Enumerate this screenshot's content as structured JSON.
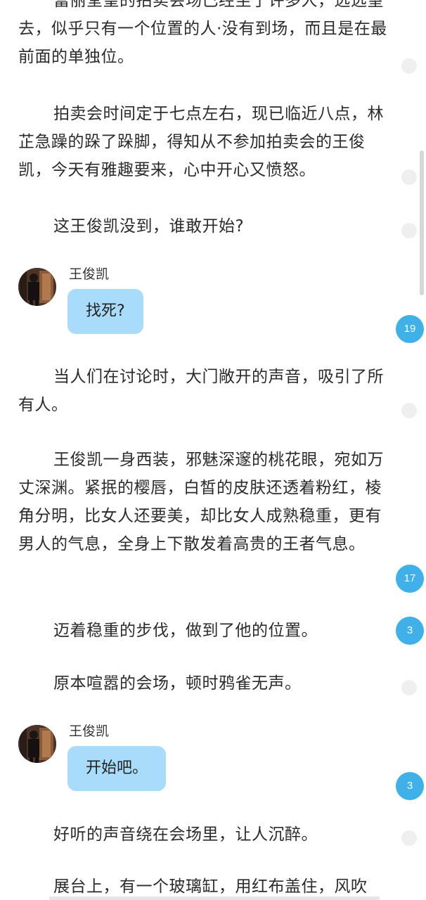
{
  "story": {
    "paragraphs": [
      "富丽堂皇的拍卖会场已经坐了许多人，远远望去，似乎只有一个位置的人·没有到场，而且是在最前面的单独位。",
      "拍卖会时间定于七点左右，现已临近八点，林芷急躁的跺了跺脚，得知从不参加拍卖会的王俊凯，今天有雅趣要来，心中开心又愤怒。",
      "这王俊凯没到，谁敢开始?",
      "当人们在讨论时，大门敞开的声音，吸引了所有人。",
      "王俊凯一身西装，邪魅深邃的桃花眼，宛如万丈深渊。紧抿的樱唇，白皙的皮肤还透着粉红，棱角分明，比女人还要美，却比女人成熟稳重，更有男人的气息，全身上下散发着高贵的王者气息。",
      "迈着稳重的步伐，做到了他的位置。",
      "原本喧嚣的会场，顿时鸦雀无声。",
      "好听的声音绕在会场里，让人沉醉。",
      "展台上，有一个玻璃缸，用红布盖住，风吹"
    ],
    "chat_messages": [
      {
        "speaker": "王俊凯",
        "text": "找死?"
      },
      {
        "speaker": "王俊凯",
        "text": "开始吧。"
      }
    ],
    "comment_counts": [
      "19",
      "17",
      "3",
      "3"
    ]
  },
  "colors": {
    "bubble": "#a9dcfa",
    "comment_badge": "#3fb1e8",
    "empty_marker": "#efefef",
    "text": "#2b2b2b"
  }
}
